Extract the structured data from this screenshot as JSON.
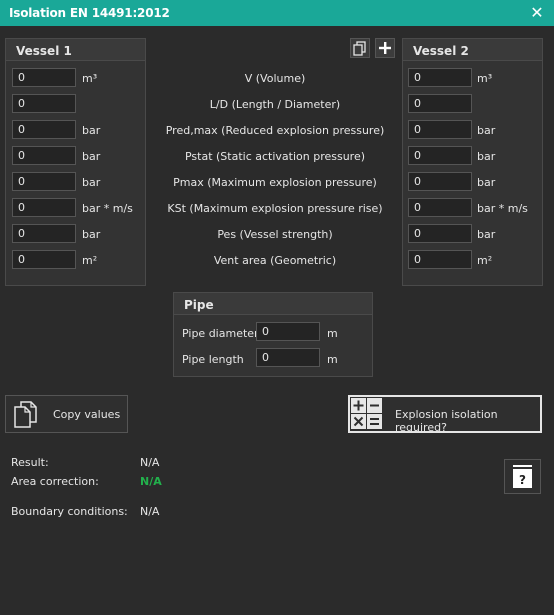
{
  "window": {
    "title": "Isolation EN 14491:2012",
    "close_glyph": "✕"
  },
  "vessel1": {
    "title": "Vessel 1",
    "values": [
      "0",
      "0",
      "0",
      "0",
      "0",
      "0",
      "0",
      "0"
    ],
    "units": [
      "m³",
      "",
      "bar",
      "bar",
      "bar",
      "bar * m/s",
      "bar",
      "m²"
    ]
  },
  "vessel2": {
    "title": "Vessel 2",
    "values": [
      "0",
      "0",
      "0",
      "0",
      "0",
      "0",
      "0",
      "0"
    ],
    "units": [
      "m³",
      "",
      "bar",
      "bar",
      "bar",
      "bar * m/s",
      "bar",
      "m²"
    ]
  },
  "parameters": [
    "V (Volume)",
    "L/D (Length / Diameter)",
    "Pred,max (Reduced explosion pressure)",
    "Pstat (Static activation pressure)",
    "Pmax (Maximum explosion pressure)",
    "KSt (Maximum explosion pressure rise)",
    "Pes (Vessel strength)",
    "Vent area (Geometric)"
  ],
  "pipe": {
    "title": "Pipe",
    "diameter_label": "Pipe diameter",
    "diameter_value": "0",
    "diameter_unit": "m",
    "length_label": "Pipe length",
    "length_value": "0",
    "length_unit": "m"
  },
  "buttons": {
    "copy_values": "Copy values",
    "explosion_isolation": "Explosion isolation required?",
    "help_glyph": "?"
  },
  "results": {
    "result_label": "Result:",
    "result_value": "N/A",
    "area_label": "Area correction:",
    "area_value": "N/A",
    "boundary_label": "Boundary conditions:",
    "boundary_value": "N/A"
  },
  "colors": {
    "title_bar": "#1aa898",
    "background": "#2b2b2b",
    "area_value": "#22b14c"
  },
  "icons": [
    "close-icon",
    "copy-icon",
    "add-icon",
    "copy-values-icon",
    "calculator-icon",
    "help-book-icon"
  ]
}
